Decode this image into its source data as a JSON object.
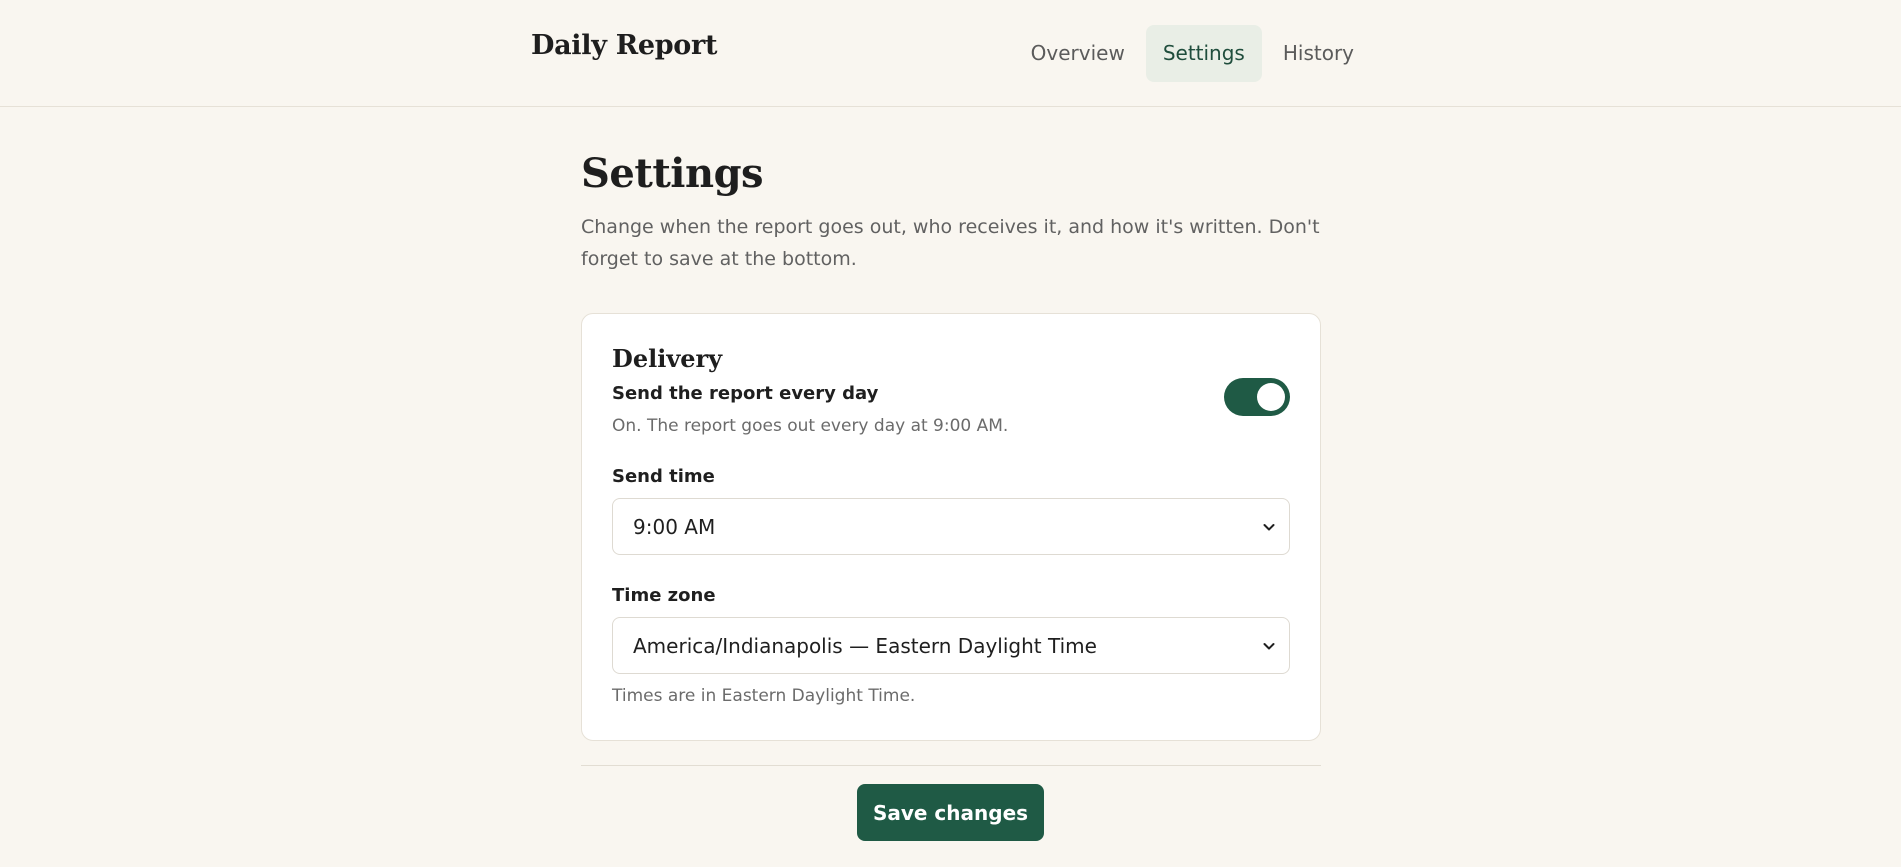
{
  "header": {
    "brand": "Daily Report",
    "tabs": [
      {
        "label": "Overview",
        "active": false
      },
      {
        "label": "Settings",
        "active": true
      },
      {
        "label": "History",
        "active": false
      }
    ]
  },
  "page": {
    "title": "Settings",
    "description": "Change when the report goes out, who receives it, and how it's written. Don't forget to save at the bottom."
  },
  "delivery": {
    "title": "Delivery",
    "toggle_label": "Send the report every day",
    "toggle_help": "On. The report goes out every day at 9:00 AM.",
    "toggle_on": true,
    "send_time_label": "Send time",
    "send_time_value": "9:00 AM",
    "timezone_label": "Time zone",
    "timezone_value": "America/Indianapolis — Eastern Daylight Time",
    "timezone_help": "Times are in Eastern Daylight Time."
  },
  "actions": {
    "save_label": "Save changes"
  },
  "colors": {
    "accent": "#1f5a45",
    "background": "#f9f6f0",
    "active_tab_bg": "#e9eee6"
  }
}
